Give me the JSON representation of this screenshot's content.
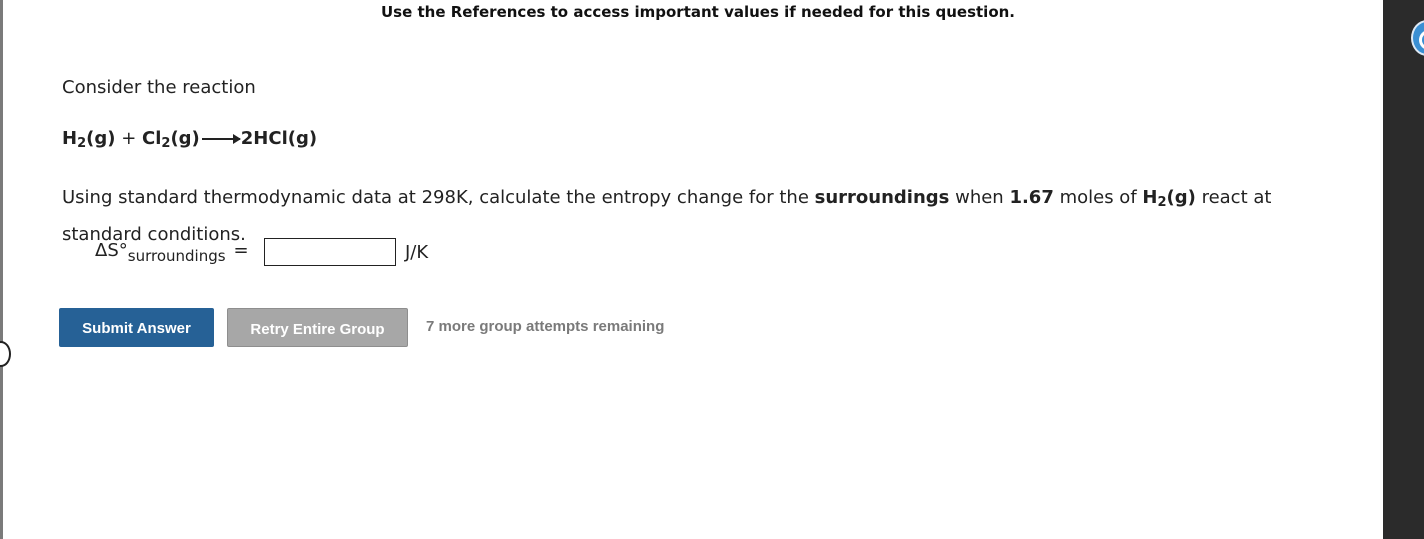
{
  "header": {
    "note": "Use the References to access important values if needed for this question."
  },
  "question": {
    "intro": "Consider the reaction",
    "equation": {
      "r1": "H",
      "r1_sub": "2",
      "r1_state": "(g)",
      "plus": " + ",
      "r2": "Cl",
      "r2_sub": "2",
      "r2_state": "(g)",
      "product": "2HCl(g)"
    },
    "prompt": {
      "part1": "Using standard thermodynamic data at 298K, calculate the entropy change for the ",
      "emphasis1": "surroundings",
      "part2": " when ",
      "amount": "1.67",
      "part3": " moles of ",
      "species": "H",
      "species_sub": "2",
      "species_state": "(g)",
      "part4": " react at standard conditions."
    },
    "answer": {
      "label_main": "ΔS°",
      "label_sub": "surroundings",
      "equals": "=",
      "value": "",
      "unit": "J/K"
    }
  },
  "actions": {
    "submit_label": "Submit Answer",
    "retry_label": "Retry Entire Group",
    "attempts_text": "7 more group attempts remaining"
  },
  "colors": {
    "submit_bg": "#266196",
    "retry_bg": "#a7a7a7",
    "attempts_text": "#7a7a7a"
  }
}
